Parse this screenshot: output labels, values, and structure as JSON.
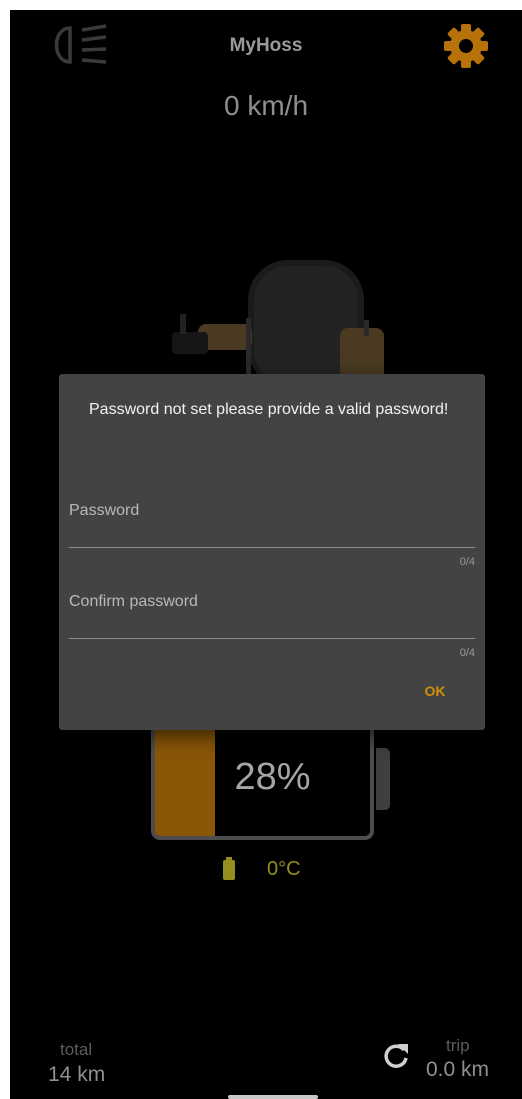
{
  "header": {
    "title": "MyHoss",
    "headlight_icon": "headlight-icon",
    "settings_icon": "gear-icon",
    "accent_color": "#d4900c"
  },
  "speed": "0 km/h",
  "battery": {
    "percent_label": "28%",
    "level": 0.28,
    "fill_color": "#8a5608"
  },
  "temperature": "0°C",
  "stats": {
    "total_label": "total",
    "total_value": "14 km",
    "trip_label": "trip",
    "trip_value": "0.0 km",
    "reset_icon": "refresh-icon"
  },
  "dialog": {
    "message": "Password not set please provide a valid password!",
    "password_label": "Password",
    "password_counter": "0/4",
    "confirm_label": "Confirm password",
    "confirm_counter": "0/4",
    "ok_label": "OK"
  }
}
